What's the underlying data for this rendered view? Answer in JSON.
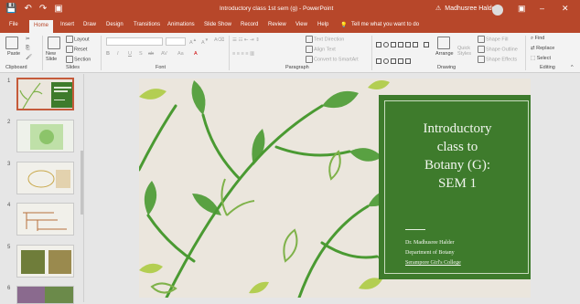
{
  "window": {
    "title": "Introductory class 1st sem (g) - PowerPoint",
    "user": "Madhusree Halder",
    "tell_me": "Tell me what you want to do",
    "qat": [
      "💾",
      "↶",
      "↷",
      "▣"
    ],
    "controls": [
      "▣",
      "–",
      "✕"
    ]
  },
  "tabs": [
    "File",
    "Home",
    "Insert",
    "Draw",
    "Design",
    "Transitions",
    "Animations",
    "Slide Show",
    "Record",
    "Review",
    "View",
    "Help"
  ],
  "ribbon": {
    "clipboard": {
      "label": "Clipboard",
      "paste": "Paste"
    },
    "slides": {
      "label": "Slides",
      "new_slide": "New Slide",
      "layout": "Layout",
      "reset": "Reset",
      "section": "Section"
    },
    "font": {
      "label": "Font",
      "styles": [
        "B",
        "I",
        "U",
        "S",
        "ab",
        "AV",
        "Aa",
        "A"
      ]
    },
    "paragraph": {
      "label": "Paragraph",
      "text_direction": "Text Direction",
      "align_text": "Align Text",
      "smartart": "Convert to SmartArt"
    },
    "drawing": {
      "label": "Drawing",
      "arrange": "Arrange",
      "quick_styles": "Quick Styles",
      "shape_fill": "Shape Fill",
      "shape_outline": "Shape Outline",
      "shape_effects": "Shape Effects"
    },
    "editing": {
      "label": "Editing",
      "find": "Find",
      "replace": "Replace",
      "select": "Select"
    }
  },
  "slides_panel": {
    "numbers": [
      "1",
      "2",
      "3",
      "4",
      "5",
      "6"
    ],
    "active": 1
  },
  "slide": {
    "title_lines": [
      "Introductory",
      "class to",
      "Botany (G):",
      "SEM 1"
    ],
    "author": "Dr. Madhusree Halder",
    "department": "Department of Botany",
    "college": "Serampore Girl's College"
  },
  "colors": {
    "accent": "#b7472a",
    "title_box": "#3e7b2c",
    "leaf_dark": "#4a9a32",
    "leaf_light": "#a9c93a"
  }
}
